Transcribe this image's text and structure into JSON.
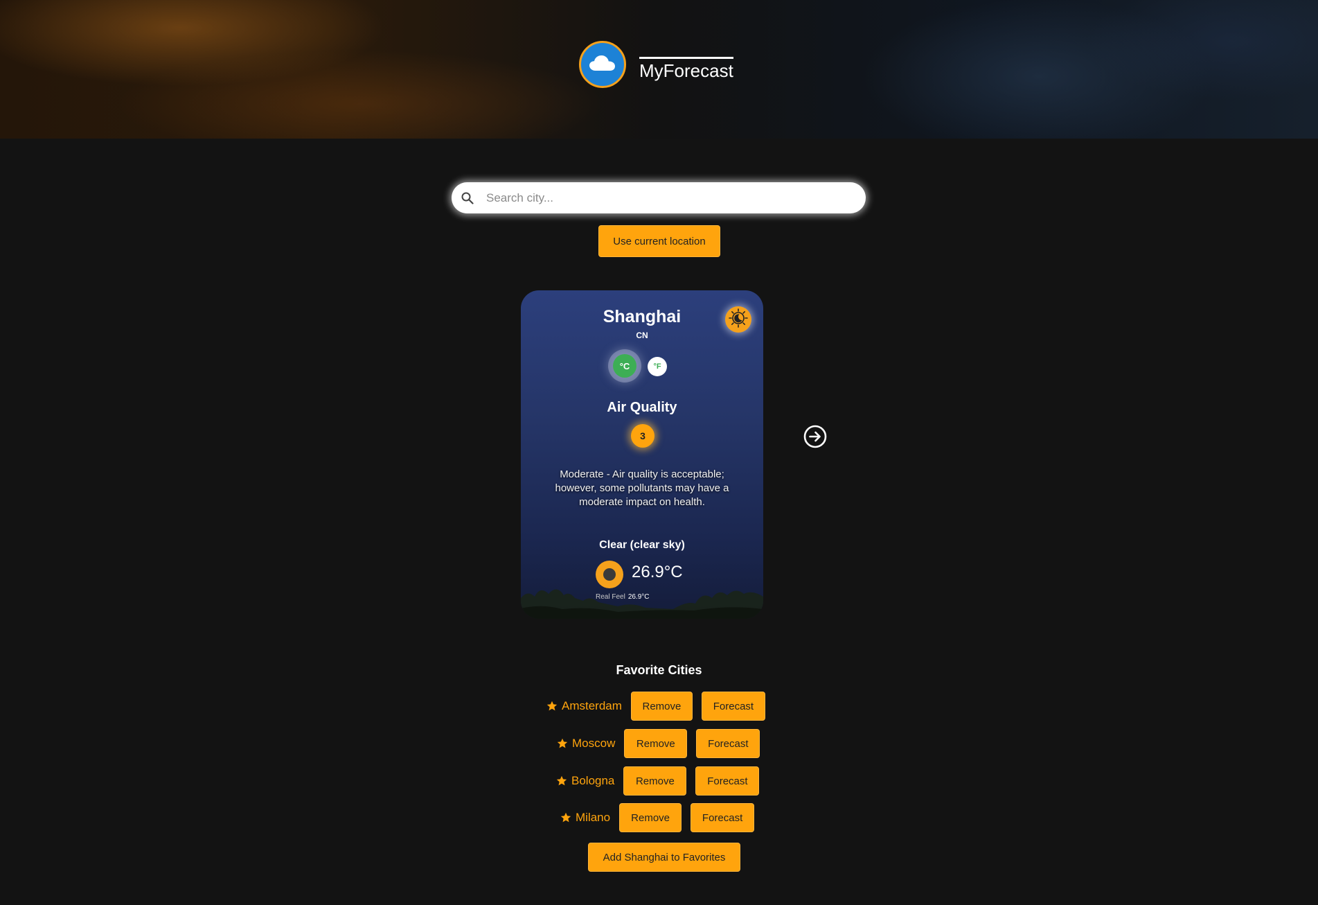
{
  "app": {
    "brand": "MyForecast",
    "accent_color": "#ffa40d",
    "logo_icon": "cloud-icon"
  },
  "search": {
    "placeholder": "Search city...",
    "value": "",
    "icon": "search-icon",
    "location_button": "Use current location"
  },
  "weather_card": {
    "city": "Shanghai",
    "country": "CN",
    "theme_toggle_icon": "sun-moon-icon",
    "units": {
      "celsius": "°C",
      "fahrenheit": "°F",
      "selected": "°C"
    },
    "air_quality": {
      "title": "Air Quality",
      "index": "3",
      "description": "Moderate - Air quality is acceptable; however, some pollutants may have a moderate impact on health."
    },
    "condition": "Clear (clear sky)",
    "condition_icon": "clear-sky-icon",
    "temperature": "26.9°C",
    "real_feel_label": "Real Feel",
    "real_feel_value": "26.9°C"
  },
  "next_icon": "arrow-right-circle-icon",
  "favorites": {
    "title": "Favorite Cities",
    "items": [
      {
        "name": "Amsterdam",
        "remove_label": "Remove",
        "forecast_label": "Forecast"
      },
      {
        "name": "Moscow",
        "remove_label": "Remove",
        "forecast_label": "Forecast"
      },
      {
        "name": "Bologna",
        "remove_label": "Remove",
        "forecast_label": "Forecast"
      },
      {
        "name": "Milano",
        "remove_label": "Remove",
        "forecast_label": "Forecast"
      }
    ],
    "add_button": "Add Shanghai to Favorites"
  }
}
